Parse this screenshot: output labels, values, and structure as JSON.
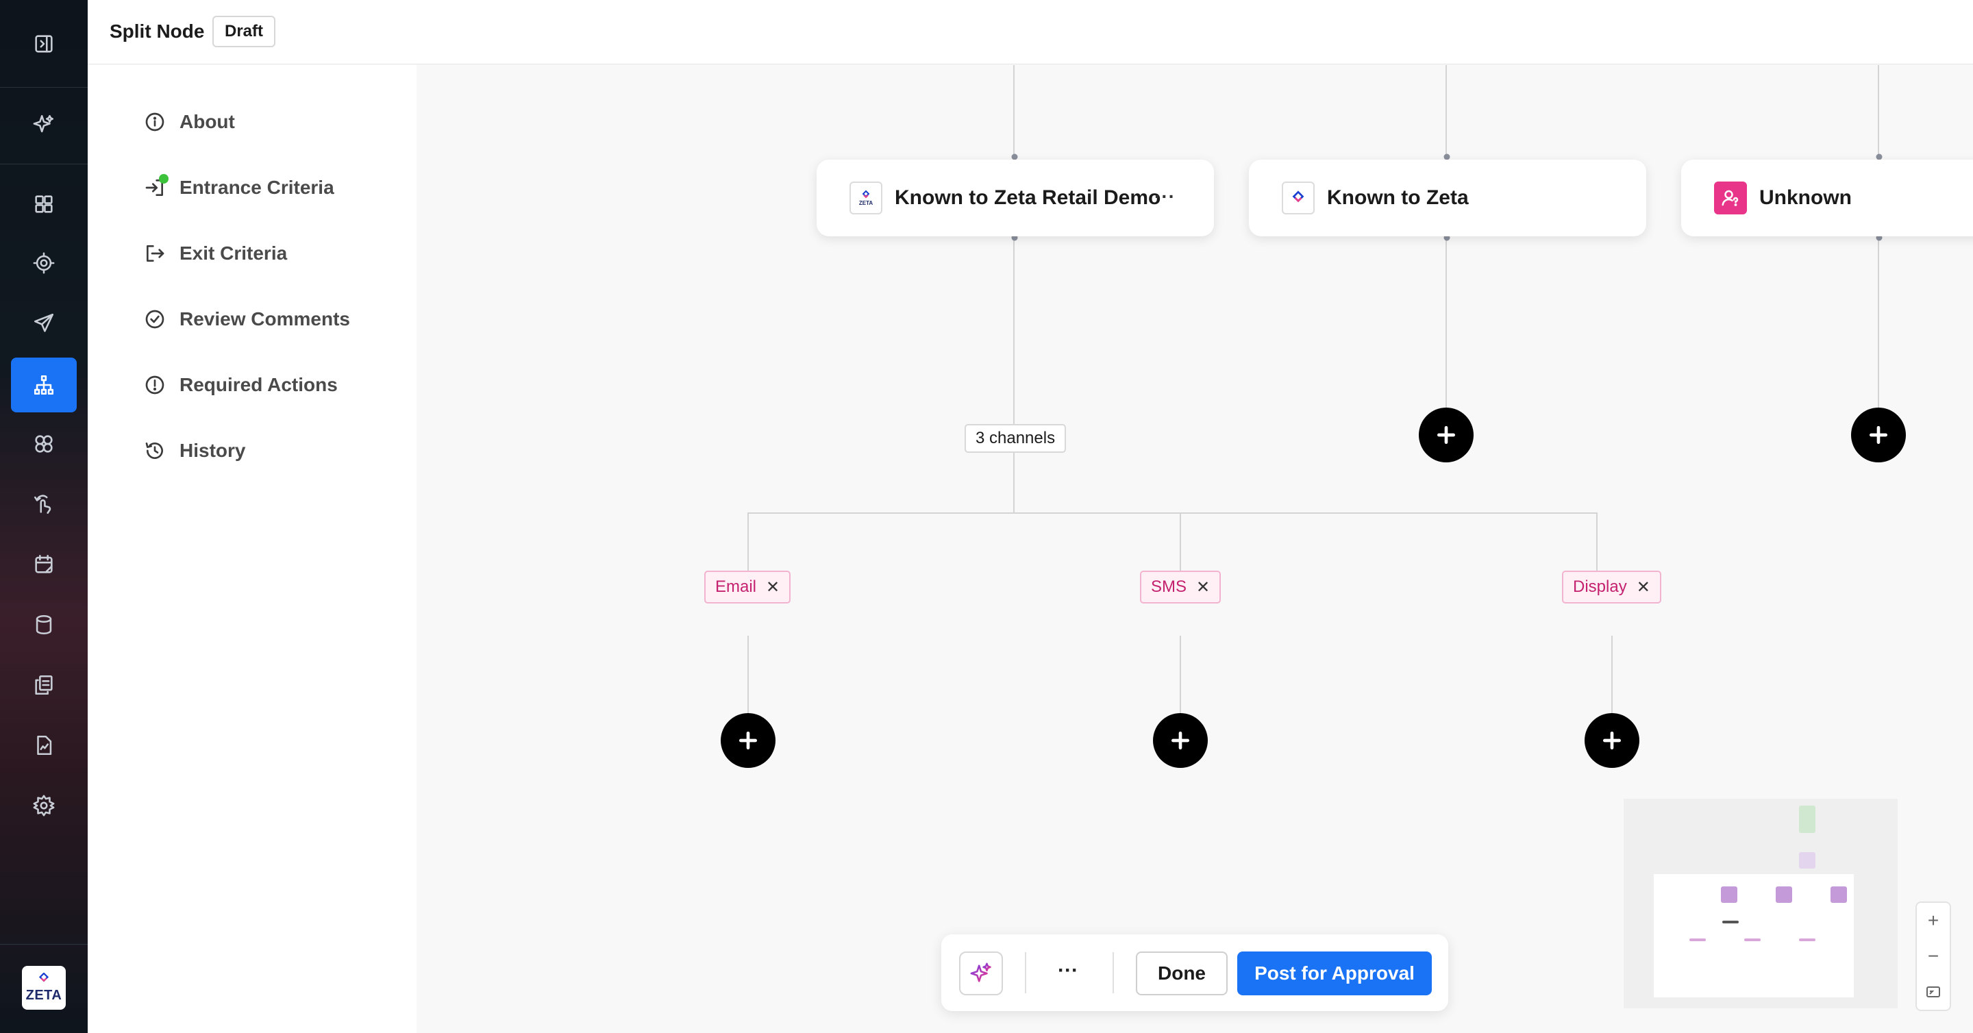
{
  "header": {
    "title": "Split Node",
    "status": "Draft"
  },
  "rail": {
    "icons": [
      "panel-toggle-icon",
      "sparkle-icon",
      "dashboard-icon",
      "target-icon",
      "send-icon",
      "journey-icon",
      "segments-icon",
      "touch-icon",
      "calendar-icon",
      "database-icon",
      "assets-icon",
      "reports-icon",
      "settings-icon"
    ],
    "active": "journey-icon",
    "logo_text": "ZETA",
    "accent": "#1a73f5"
  },
  "panel": {
    "items": [
      {
        "label": "About",
        "icon": "info-icon"
      },
      {
        "label": "Entrance Criteria",
        "icon": "entrance-icon",
        "status": "complete"
      },
      {
        "label": "Exit Criteria",
        "icon": "exit-icon"
      },
      {
        "label": "Review Comments",
        "icon": "check-circle-icon"
      },
      {
        "label": "Required Actions",
        "icon": "alert-icon"
      },
      {
        "label": "History",
        "icon": "history-icon"
      }
    ]
  },
  "canvas": {
    "nodes": [
      {
        "label": "Known to Zeta Retail Demo",
        "icon": "zeta-retail-icon",
        "more": "···"
      },
      {
        "label": "Known to Zeta",
        "icon": "zeta-icon"
      },
      {
        "label": "Unknown",
        "icon": "unknown-user-icon"
      }
    ],
    "channels_chip": "3 channels",
    "channels": [
      "Email",
      "SMS",
      "Display"
    ],
    "remove_glyph": "✕"
  },
  "actionbar": {
    "more": "···",
    "done": "Done",
    "post": "Post for Approval"
  },
  "zoom": {
    "in": "+",
    "out": "−"
  }
}
